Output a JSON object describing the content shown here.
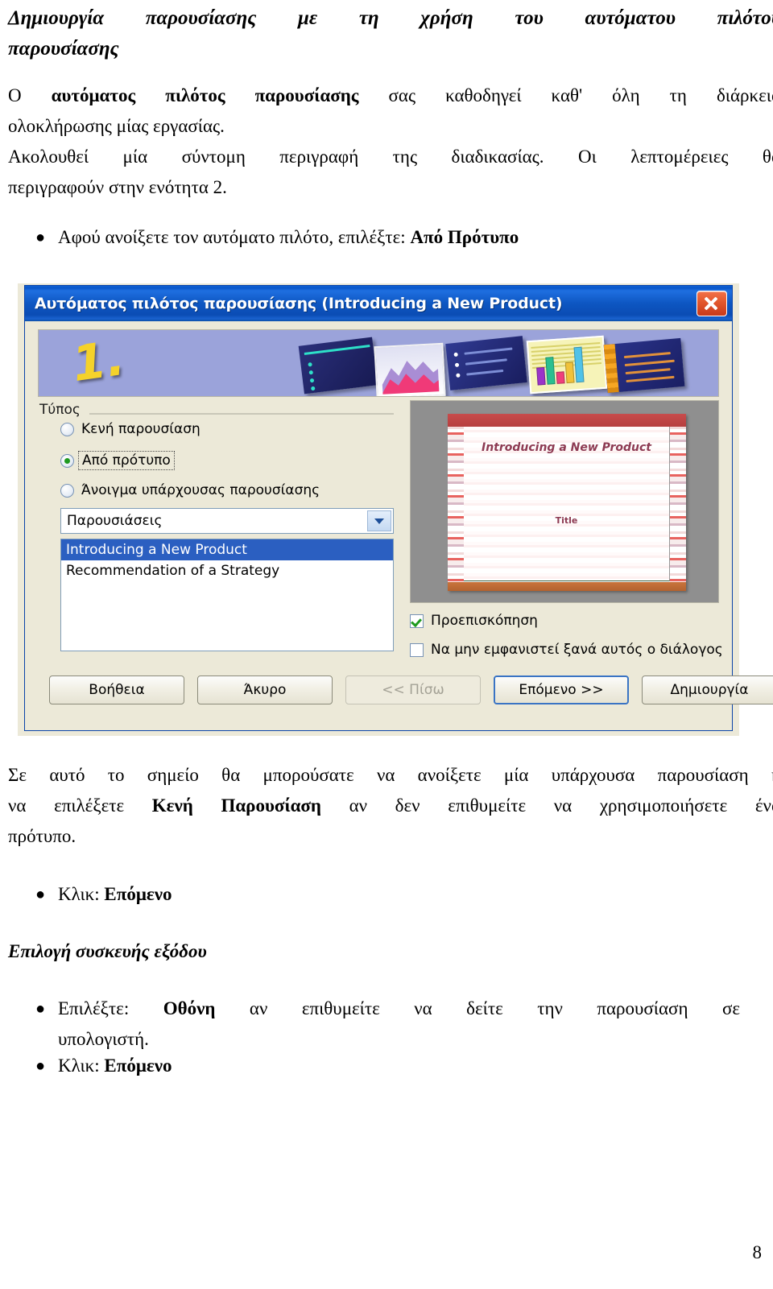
{
  "document": {
    "heading_line1": "Δημιουργία παρουσίασης με τη χρήση του αυτόματου πιλότου",
    "heading_line2": "παρουσίασης",
    "para1_pre": "Ο ",
    "para1_bold": "αυτόματος πιλότος παρουσίασης",
    "para1_post": " σας καθοδηγεί καθ' όλη τη διάρκεια",
    "para1_line2": "ολοκλήρωσης μίας εργασίας.",
    "para2_line1": "Ακολουθεί μία σύντομη περιγραφή της διαδικασίας.   Οι λεπτομέρειες θα",
    "para2_line2": "περιγραφούν στην ενότητα 2.",
    "bullet1_pre": "Αφού ανοίξετε τον αυτόματο πιλότο, επιλέξτε: ",
    "bullet1_bold": "Από Πρότυπο",
    "para3_line1": "Σε αυτό το σημείο θα μπορούσατε να ανοίξετε μία υπάρχουσα παρουσίαση ή",
    "para3_line2_pre": "να επιλέξετε ",
    "para3_line2_bold": "Κενή Παρουσίαση",
    "para3_line2_post": " αν δεν επιθυμείτε να χρησιμοποιήσετε ένα",
    "para3_line3": "πρότυπο.",
    "bullet2_pre": "Κλικ: ",
    "bullet2_bold": "Επόμενο",
    "subheading": "Επιλογή συσκευής εξόδου",
    "bullet3_pre": "Επιλέξτε: ",
    "bullet3_bold": "Οθόνη",
    "bullet3_post": " αν επιθυμείτε να δείτε την παρουσίαση σε έναν",
    "bullet3_line2": "υπολογιστή.",
    "bullet4_pre": "Κλικ: ",
    "bullet4_bold": "Επόμενο",
    "bullet_glyph": "●",
    "page_number": "8"
  },
  "dialog": {
    "title": "Αυτόματος πιλότος παρουσίασης (Introducing a New Product)",
    "close_icon": "close-icon",
    "banner": {
      "step_number": "1.",
      "thumbnails": [
        "slide-thumbnail-title",
        "slide-thumbnail-chart-area",
        "slide-thumbnail-bullets",
        "slide-thumbnail-bar-chart",
        "slide-thumbnail-notes"
      ]
    },
    "group": {
      "label": "Τύπος",
      "radios": [
        {
          "label": "Κενή παρουσίαση",
          "selected": false,
          "focused": false
        },
        {
          "label": "Από πρότυπο",
          "selected": true,
          "focused": true
        },
        {
          "label": "Άνοιγμα υπάρχουσας παρουσίασης",
          "selected": false,
          "focused": false
        }
      ]
    },
    "combo": {
      "value": "Παρουσιάσεις",
      "arrow_icon": "chevron-down-icon"
    },
    "listbox": {
      "items": [
        {
          "label": "Introducing a New Product",
          "selected": true
        },
        {
          "label": "Recommendation of a Strategy",
          "selected": false
        }
      ]
    },
    "preview": {
      "slide_title": "Introducing a New Product",
      "slide_subtitle": "Title"
    },
    "checkboxes": [
      {
        "label": "Προεπισκόπηση",
        "checked": true
      },
      {
        "label": "Να μην εμφανιστεί ξανά αυτός ο διάλογος",
        "checked": false
      }
    ],
    "buttons": [
      {
        "label": "Βοήθεια",
        "state": "normal"
      },
      {
        "label": "Άκυρο",
        "state": "normal"
      },
      {
        "label": "<< Πίσω",
        "state": "disabled"
      },
      {
        "label": "Επόμενο >>",
        "state": "default"
      },
      {
        "label": "Δημιουργία",
        "state": "normal"
      }
    ]
  },
  "colors": {
    "titlebar": "#0a56c8",
    "dialog_bg": "#ece9d8",
    "banner_bg": "#9ba3da",
    "selection": "#2b5fc1",
    "preview_bg": "#8f8f8f",
    "close_button": "#d6431f",
    "check_green": "#1f9a1f"
  }
}
